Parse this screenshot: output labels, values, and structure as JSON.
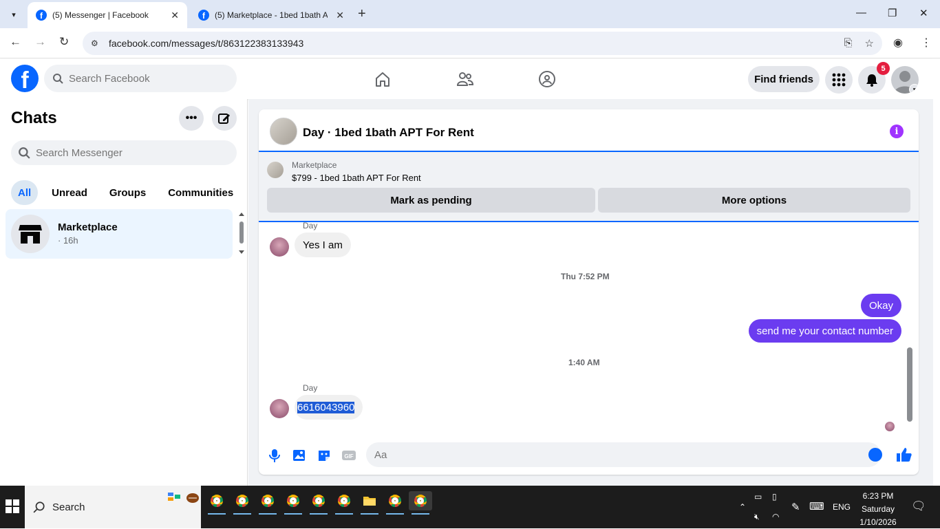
{
  "browser": {
    "tabs": [
      {
        "title": "(5) Messenger | Facebook",
        "active": true
      },
      {
        "title": "(5) Marketplace - 1bed 1bath A",
        "active": false
      }
    ],
    "url": "facebook.com/messages/t/863122383133943"
  },
  "fb": {
    "search_placeholder": "Search Facebook",
    "find_friends": "Find friends",
    "notif_count": "5"
  },
  "chats": {
    "title": "Chats",
    "search_placeholder": "Search Messenger",
    "filters": [
      "All",
      "Unread",
      "Groups",
      "Communities"
    ],
    "items": [
      {
        "name": "Marketplace",
        "time": "· 16h"
      }
    ]
  },
  "conversation": {
    "title": "Day · 1bed 1bath APT For Rent",
    "marketplace_label": "Marketplace",
    "listing": "$799 - 1bed 1bath APT For Rent",
    "mark_pending": "Mark as pending",
    "more_options": "More options",
    "messages": [
      {
        "sender": "Day",
        "text": "Yes I am",
        "dir": "in"
      },
      {
        "timestamp": "Thu 7:52 PM"
      },
      {
        "text": "Okay",
        "dir": "out"
      },
      {
        "text": "send me your contact number",
        "dir": "out"
      },
      {
        "timestamp": "1:40 AM"
      },
      {
        "sender": "Day",
        "text": "6616043960",
        "dir": "in"
      }
    ],
    "composer_placeholder": "Aa"
  },
  "taskbar": {
    "search_label": "Search",
    "lang": "ENG",
    "time": "6:23 PM",
    "day": "Saturday",
    "date": "1/10/2026"
  }
}
